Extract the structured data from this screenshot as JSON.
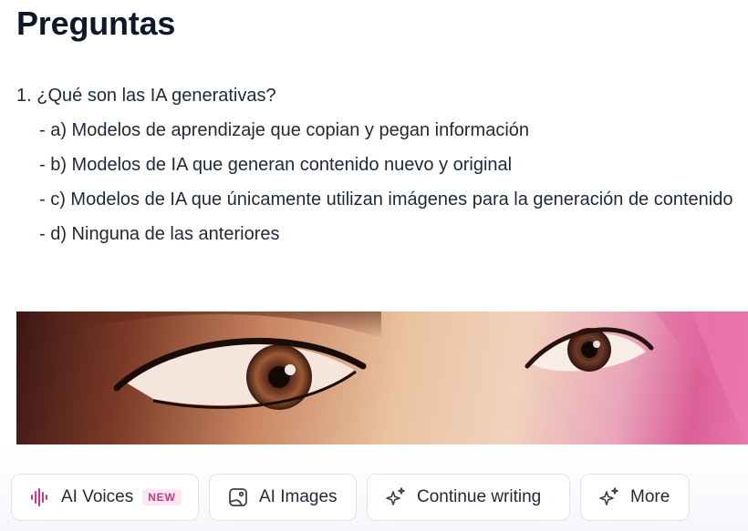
{
  "page": {
    "title": "Preguntas"
  },
  "question": {
    "text": "1. ¿Qué son las IA generativas?",
    "options": [
      "- a) Modelos de aprendizaje que copian y pegan información",
      "- b) Modelos de IA que generan contenido nuevo y original",
      "- c) Modelos de IA que únicamente utilizan imágenes para la generación de contenido",
      "- d) Ninguna de las anteriores"
    ]
  },
  "image": {
    "description_icon": "eyes-closeup-image"
  },
  "toolbar": {
    "ai_voices_label": "AI Voices",
    "ai_voices_badge": "NEW",
    "ai_images_label": "AI Images",
    "continue_label": "Continue writing",
    "more_label": "More"
  },
  "colors": {
    "accent_pink": "#d63384",
    "badge_bg": "#fde7f1",
    "title": "#0f172a"
  }
}
